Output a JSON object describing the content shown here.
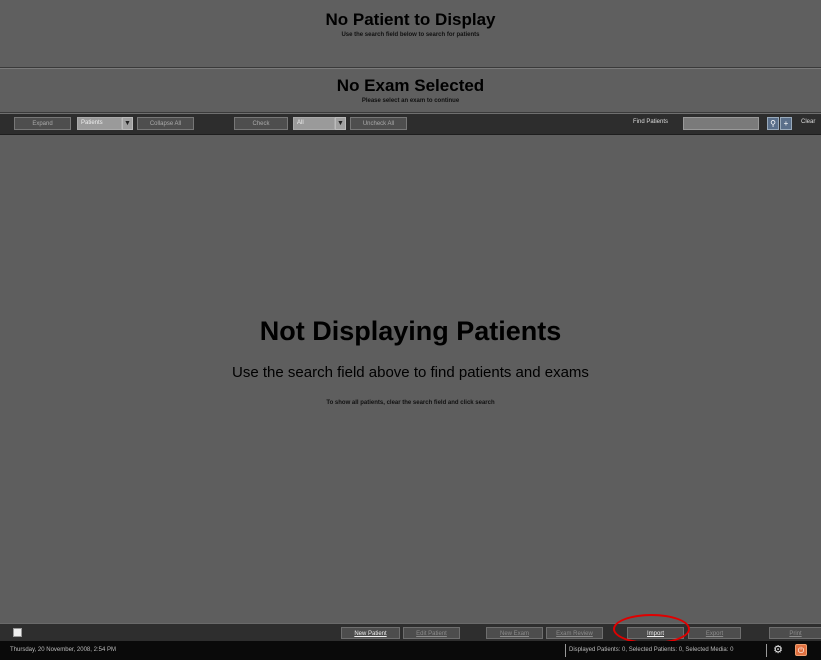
{
  "patient_header": {
    "title": "No Patient to Display",
    "subtitle": "Use the search field below to search for patients"
  },
  "exam_header": {
    "title": "No Exam Selected",
    "subtitle": "Please select an exam to continue"
  },
  "toolbar": {
    "expand_label": "Expand",
    "expand_select": "Patients",
    "collapse_label": "Collapse All",
    "check_label": "Check",
    "check_select": "All",
    "uncheck_label": "Uncheck All",
    "find_label": "Find Patients",
    "find_value": "",
    "clear_label": "Clear"
  },
  "main": {
    "title": "Not Displaying Patients",
    "subtitle": "Use the search field above to find patients and exams",
    "hint": "To show all patients, clear the search field and click search"
  },
  "actions": {
    "new_patient": "New Patient",
    "edit_patient": "Edit Patient",
    "new_exam": "New Exam",
    "exam_review": "Exam Review",
    "import": "Import",
    "export": "Export",
    "print": "Print"
  },
  "status": {
    "date": "Thursday, 20 November, 2008, 2:54 PM",
    "info": "Displayed Patients: 0, Selected Patients: 0, Selected Media: 0"
  },
  "icons": {
    "dropdown": "chevron-down-icon",
    "search": "search-icon",
    "add": "plus-icon",
    "settings": "gear-icon",
    "power": "power-icon"
  },
  "colors": {
    "background": "#5e5e5e",
    "toolbar": "#2d2d2d",
    "status_bar": "#0a0a0a",
    "highlight_circle": "#e00000"
  }
}
